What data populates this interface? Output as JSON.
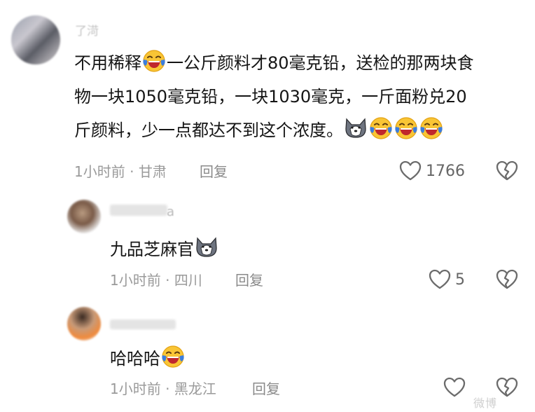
{
  "comment": {
    "username": "了渮",
    "text_segments": [
      "不用稀释",
      "一公斤颜料才80毫克铅，送检的那两块食",
      "物一块1050毫克铅，一块1030毫克，一斤面粉兑20",
      "斤颜料，少一点都达不到这个浓度。"
    ],
    "time": "1小时前",
    "separator": "·",
    "location": "甘肃",
    "reply_label": "回复",
    "likes": "1766"
  },
  "replies": [
    {
      "username_tail": "a",
      "text": "九品芝麻官",
      "time": "1小时前",
      "separator": "·",
      "location": "四川",
      "reply_label": "回复",
      "likes": "5"
    },
    {
      "text": "哈哈哈",
      "time": "1小时前",
      "separator": "·",
      "location": "黑龙江",
      "reply_label": "回复"
    }
  ],
  "watermark": "微博",
  "icons": {
    "like": "heart-outline-icon",
    "dislike": "broken-heart-icon",
    "emoji_laugh": "crying-laughing-emoji",
    "emoji_husky": "husky-emoji"
  },
  "colors": {
    "text": "#151515",
    "meta": "#9a9a9a",
    "icon": "#6b6b6b",
    "emoji_yellow": "#f9c535",
    "emoji_blue": "#3b7dde"
  }
}
